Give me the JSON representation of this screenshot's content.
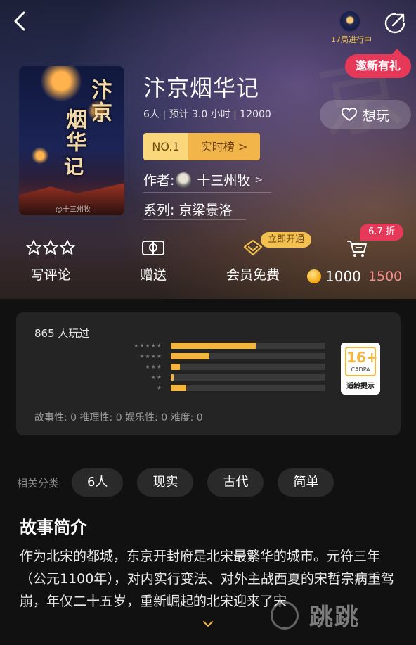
{
  "header": {
    "games_running": "17局进行中",
    "invite_label": "邀新有礼"
  },
  "game": {
    "cover_title_line1": "汴京",
    "cover_title_line2": "烟华",
    "cover_title_line3": "记",
    "cover_credit": "@十三州牧",
    "title": "汴京烟华记",
    "meta": "6人 | 预计 3.0 小时 | 12000",
    "want_label": "想玩",
    "rank_no": "NO.1",
    "rank_list": "实时榜 >",
    "author_label": "作者:",
    "author_name": "十三州牧",
    "author_arrow": ">",
    "series": "系列: 京梁景洛"
  },
  "actions": {
    "review": "写评论",
    "gift": "赠送",
    "vip_free": "会员免费",
    "vip_tag": "立即开通",
    "discount": "6.7 折",
    "price": "1000",
    "old_price": "1500"
  },
  "stats": {
    "players": "865 人玩过",
    "rating_rows": [
      {
        "stars": "★★★★★",
        "fraction": 0.55
      },
      {
        "stars": "★★★★",
        "fraction": 0.25
      },
      {
        "stars": "★★★",
        "fraction": 0.06
      },
      {
        "stars": "★★",
        "fraction": 0.02
      },
      {
        "stars": "★",
        "fraction": 0.1
      }
    ],
    "age_rating": "16+",
    "age_org": "CADPA",
    "age_note": "适龄提示",
    "scores": "故事性: 0   推理性: 0   娱乐性: 0   难度: 0"
  },
  "tags": {
    "label": "相关分类",
    "items": [
      "6人",
      "现实",
      "古代",
      "简单"
    ]
  },
  "synopsis": {
    "title": "故事简介",
    "text": "作为北宋的都城，东京开封府是北宋最繁华的城市。元符三年（公元1100年），对内实行变法、对外主战西夏的宋哲宗病重驾崩，年仅二十五岁，重新崛起的北宋迎来了宋"
  },
  "watermark": "跳跳"
}
